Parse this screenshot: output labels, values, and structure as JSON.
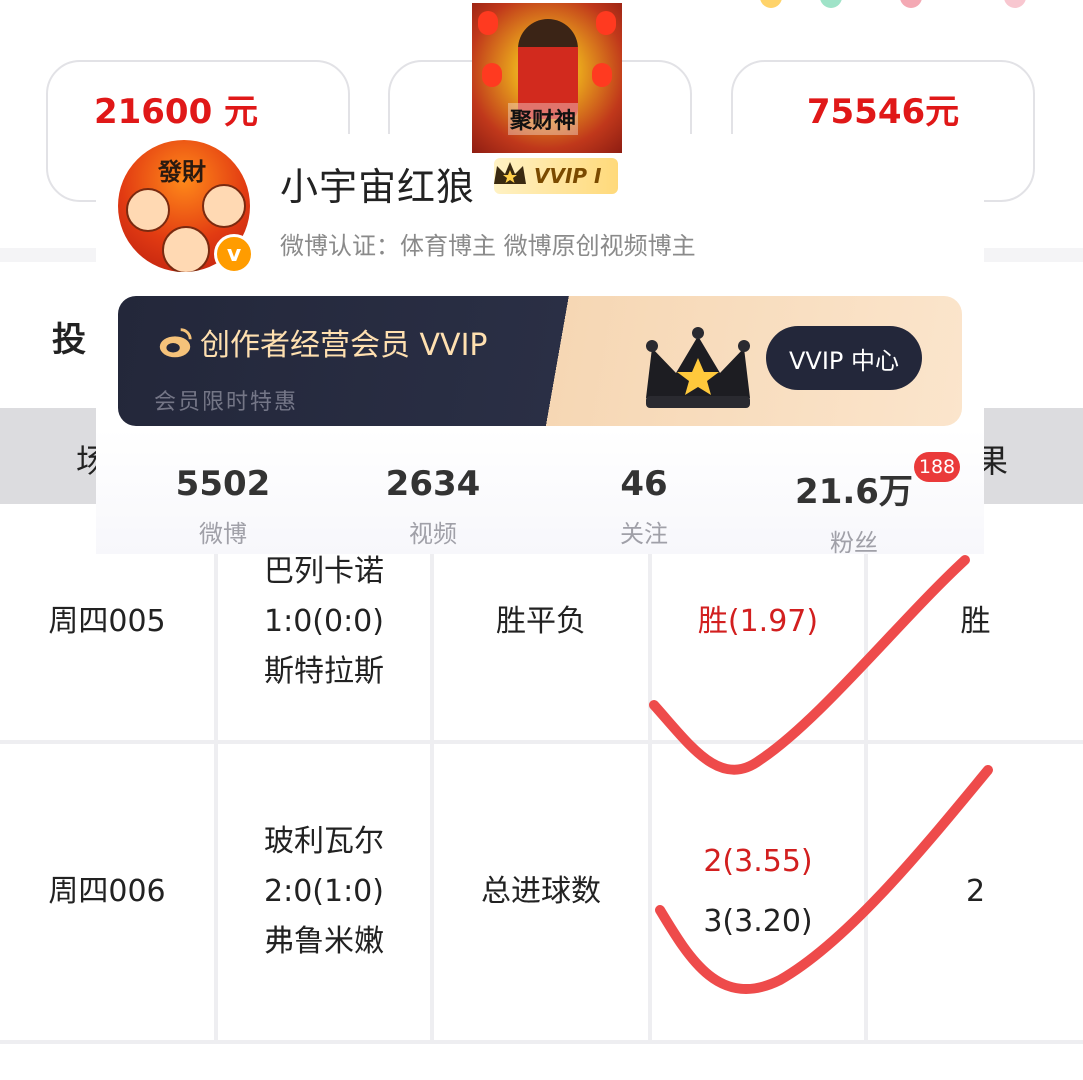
{
  "stat_cards": {
    "left_value": "21600 元",
    "right_value": "75546元"
  },
  "god_image": {
    "label": "聚财神"
  },
  "profile": {
    "avatar_text": "發財",
    "username": "小宇宙红狼",
    "vvip_tag": "VVIP I",
    "verification": "微博认证：体育博主 微博原创视频博主",
    "banner": {
      "title": "创作者经营会员 VVIP",
      "subtitle": "会员限时特惠",
      "button": "VVIP 中心"
    },
    "stats": [
      {
        "num": "5502",
        "label": "微博"
      },
      {
        "num": "2634",
        "label": "视频"
      },
      {
        "num": "46",
        "label": "关注"
      },
      {
        "num": "21.6万",
        "label": "粉丝"
      }
    ],
    "fans_badge": "188"
  },
  "table": {
    "title_partial": "投",
    "header_left": "场",
    "header_right": "果",
    "rows": [
      {
        "id": "周四005",
        "match": [
          "巴列卡诺",
          "1:0(0:0)",
          "斯特拉斯"
        ],
        "play": "胜平负",
        "picks": [
          {
            "text": "胜(1.97)",
            "color": "#d21f1f"
          }
        ],
        "result": "胜"
      },
      {
        "id": "周四006",
        "match": [
          "玻利瓦尔",
          "2:0(1:0)",
          "弗鲁米嫩"
        ],
        "play": "总进球数",
        "picks": [
          {
            "text": "2(3.55)",
            "color": "#d21f1f"
          },
          {
            "text": "3(3.20)",
            "color": "#222222"
          }
        ],
        "result": "2"
      }
    ]
  },
  "colors": {
    "accent_red": "#e01818",
    "check_red": "#ee4b4b",
    "badge_red": "#ea3a3a"
  }
}
